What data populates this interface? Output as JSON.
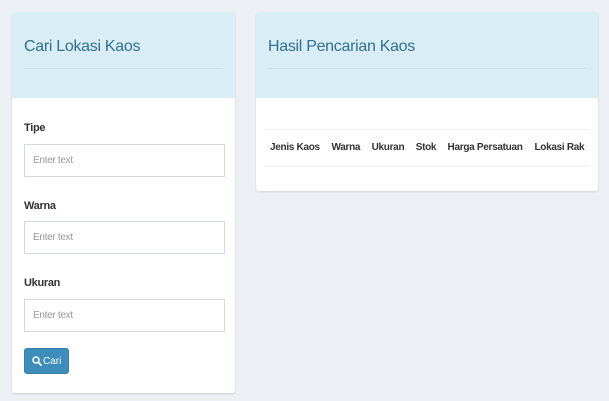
{
  "search_panel": {
    "title": "Cari Lokasi Kaos",
    "fields": [
      {
        "label": "Tipe",
        "placeholder": "Enter text",
        "value": ""
      },
      {
        "label": "Warna",
        "placeholder": "Enter text",
        "value": ""
      },
      {
        "label": "Ukuran",
        "placeholder": "Enter text",
        "value": ""
      }
    ],
    "button": {
      "label": "Cari",
      "icon": "search-icon"
    }
  },
  "results_panel": {
    "title": "Hasil Pencarian Kaos",
    "columns": [
      "Jenis Kaos",
      "Warna",
      "Ukuran",
      "Stok",
      "Harga Persatuan",
      "Lokasi Rak"
    ],
    "rows": []
  },
  "colors": {
    "page_background": "#ecf0f5",
    "header_background": "#d9edf7",
    "title_text": "#31708f",
    "button_primary": "#3c8dbc"
  }
}
